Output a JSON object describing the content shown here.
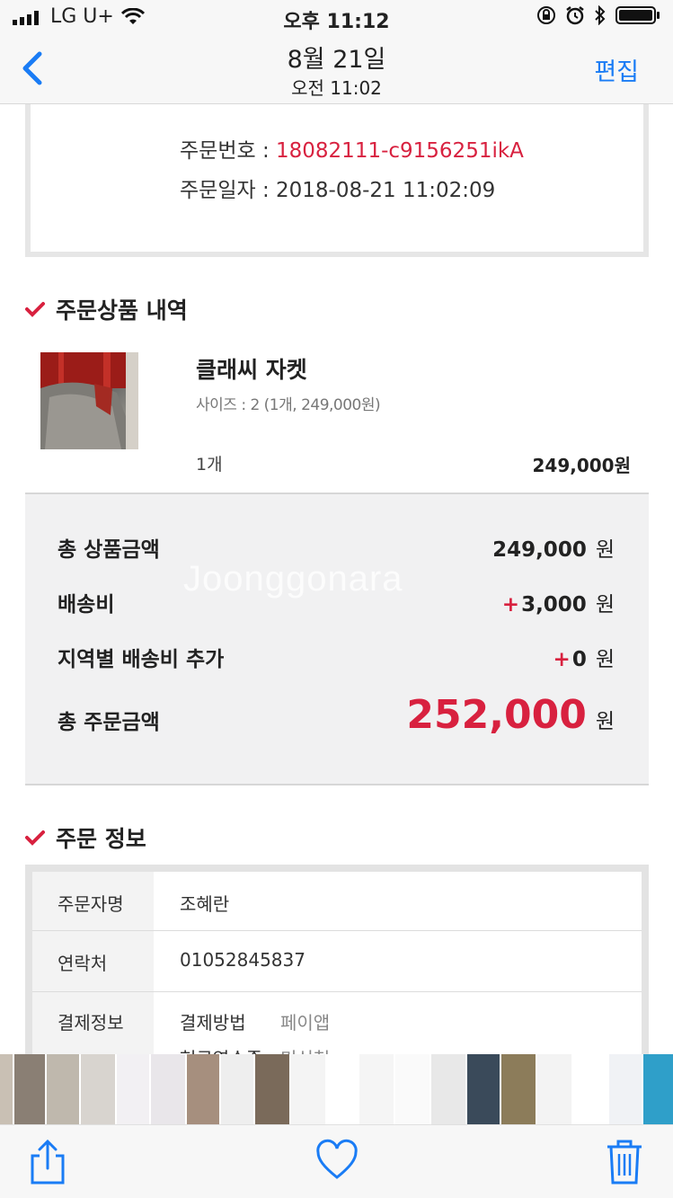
{
  "status_bar": {
    "carrier": "LG U+",
    "time": "오후 11:12",
    "icons": [
      "signal-icon",
      "wifi-icon",
      "rotation-lock-icon",
      "alarm-icon",
      "bluetooth-icon",
      "battery-icon"
    ]
  },
  "nav": {
    "title": "8월 21일",
    "subtitle": "오전 11:02",
    "edit_label": "편집",
    "back_icon": "chevron-left-icon"
  },
  "order": {
    "number_label": "주문번호 : ",
    "number_value": "18082111-c9156251ikA",
    "date_label": "주문일자 : ",
    "date_value": "2018-08-21 11:02:09"
  },
  "products_section": {
    "title": "주문상품 내역",
    "item": {
      "name": "클래씨 자켓",
      "option": "사이즈 : 2 (1개, 249,000원)",
      "qty": "1개",
      "price": "249,000원"
    }
  },
  "summary": {
    "watermark": "Joonggonara",
    "rows": [
      {
        "label": "총 상품금액",
        "plus": "",
        "value": "249,000",
        "unit": "원"
      },
      {
        "label": "배송비",
        "plus": "+",
        "value": "3,000",
        "unit": "원"
      },
      {
        "label": "지역별 배송비 추가",
        "plus": "+",
        "value": "0",
        "unit": "원"
      }
    ],
    "total_label": "총 주문금액",
    "total_value": "252,000",
    "total_unit": "원"
  },
  "order_info_section": {
    "title": "주문 정보",
    "rows": [
      {
        "label": "주문자명",
        "value": "조혜란"
      },
      {
        "label": "연락처",
        "value": "01052845837"
      },
      {
        "label": "결제정보",
        "value": "결제방법",
        "sub": "페이앱"
      }
    ],
    "extra_row": {
      "value": "현금영수증",
      "sub": "미신청"
    }
  },
  "thumb_colors": [
    "#c9c0b4",
    "#8a7f74",
    "#bfb8ad",
    "#d8d4cf",
    "#f2f0f3",
    "#e9e6ea",
    "#a68f7e",
    "#eeeeee",
    "#7a6a5a",
    "#f4f4f4",
    "#ffffff",
    "#f5f5f5",
    "#fafafa",
    "#e8e8e8",
    "#3a4a5a",
    "#8c7c5a",
    "#f3f3f3",
    "#ffffff",
    "#f0f2f5",
    "#2f9fc9",
    "#f4f0ee",
    "#c8642a",
    "#b02a20"
  ],
  "toolbar": {
    "share_icon": "share-icon",
    "favorite_icon": "heart-icon",
    "delete_icon": "trash-icon"
  },
  "colors": {
    "accent_red": "#d8213f",
    "ios_blue": "#1a7cf5"
  }
}
